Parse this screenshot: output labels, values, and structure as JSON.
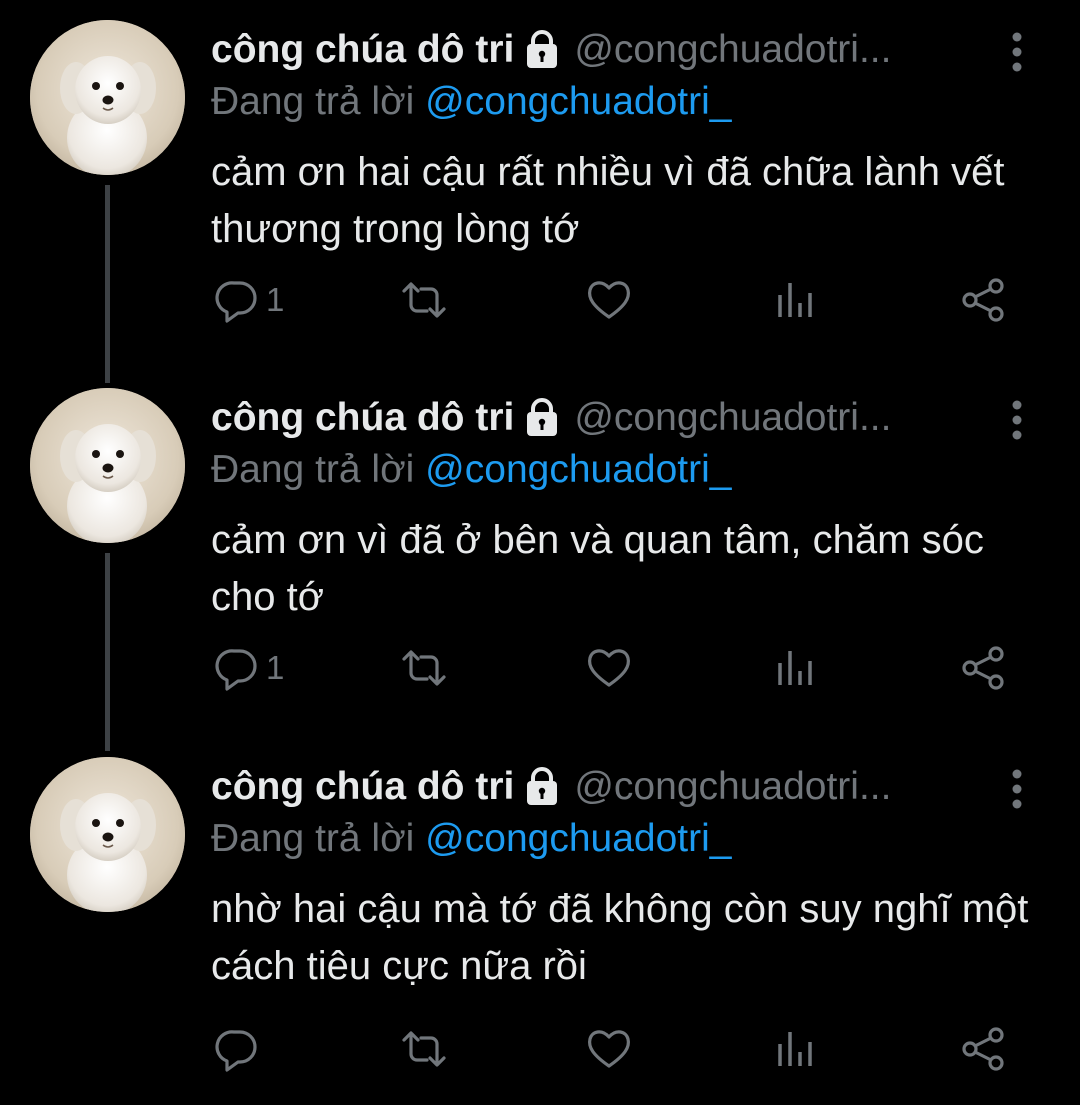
{
  "theme": {
    "background": "#000000",
    "text_primary": "#e7e9ea",
    "text_secondary": "#71767b",
    "mention_color": "#1d9bf0",
    "thread_line": "#3d4145"
  },
  "tweets": [
    {
      "display_name": "công chúa dô tri",
      "handle": "@congchuadotri...",
      "reply_prefix": "Đang trả lời",
      "reply_mention": "@congchuadotri_",
      "text": "cảm ơn hai cậu rất nhiều vì đã chữa lành vết thương trong lòng tớ",
      "reply_count": "1",
      "icons": [
        "lock-icon",
        "more-icon",
        "reply-icon",
        "retweet-icon",
        "like-icon",
        "analytics-icon",
        "share-icon"
      ]
    },
    {
      "display_name": "công chúa dô tri",
      "handle": "@congchuadotri...",
      "reply_prefix": "Đang trả lời",
      "reply_mention": "@congchuadotri_",
      "text": "cảm ơn vì đã ở bên và quan tâm, chăm sóc cho tớ",
      "reply_count": "1",
      "icons": [
        "lock-icon",
        "more-icon",
        "reply-icon",
        "retweet-icon",
        "like-icon",
        "analytics-icon",
        "share-icon"
      ]
    },
    {
      "display_name": "công chúa dô tri",
      "handle": "@congchuadotri...",
      "reply_prefix": "Đang trả lời",
      "reply_mention": "@congchuadotri_",
      "text": "nhờ hai cậu mà tớ đã không còn suy nghĩ một cách tiêu cực nữa rồi",
      "reply_count": "",
      "icons": [
        "lock-icon",
        "more-icon",
        "reply-icon",
        "retweet-icon",
        "like-icon",
        "analytics-icon",
        "share-icon"
      ]
    }
  ]
}
